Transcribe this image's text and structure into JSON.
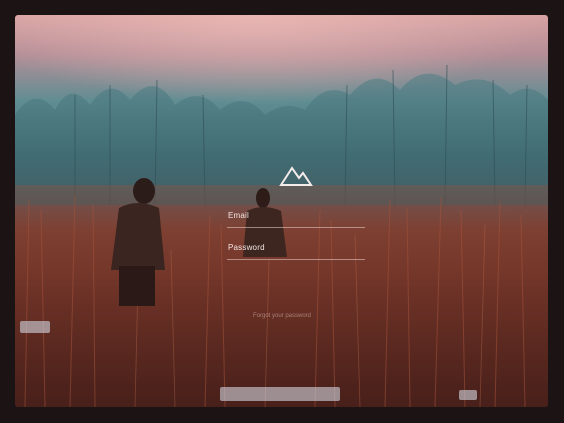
{
  "login": {
    "logo_icon": "mountain-icon",
    "email_label": "Email",
    "password_label": "Password",
    "forgot_link": "Forgot your password"
  },
  "colors": {
    "text": "#f3e6e3",
    "divider": "#ebd2cd"
  }
}
